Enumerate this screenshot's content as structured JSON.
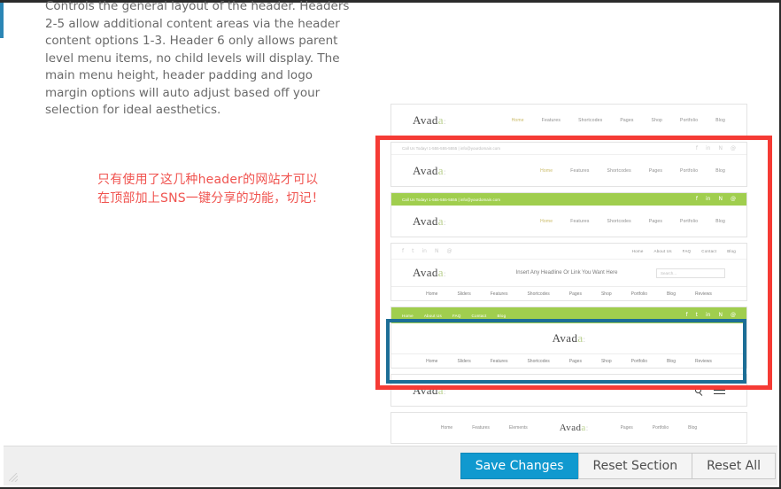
{
  "description": "Controls the general layout of the header. Headers 2-5 allow additional content areas via the header content options 1-3. Header 6 only allows parent level menu items, no child levels will display. The main menu height, header padding and logo margin options will auto adjust based off your selection for ideal aesthetics.",
  "annotation": {
    "line1": "只有使用了这几种header的网站才可以",
    "line2": "在顶部加上SNS一键分享的功能，切记！",
    "color": "#f0534f"
  },
  "colors": {
    "accent_blue": "#1099cf",
    "highlight_red": "#f53b35",
    "highlight_blue": "#1c6e96",
    "avada_green": "#a0ce4e",
    "menu_active": "#c9b964"
  },
  "logo": {
    "main": "Avad",
    "accent": "a",
    "mark": ":"
  },
  "common": {
    "contact": "Call Us Today! 1-555-555-5555 | info@yourdomain.com",
    "search_placeholder": "Search...",
    "headline": "Insert Any Headline Or Link You Want Here"
  },
  "socials": [
    {
      "name": "facebook-icon",
      "glyph": "f"
    },
    {
      "name": "twitter-icon",
      "glyph": "t"
    },
    {
      "name": "linkedin-icon",
      "glyph": "in"
    },
    {
      "name": "flickr-icon",
      "glyph": "N"
    },
    {
      "name": "rss-icon",
      "glyph": "@"
    }
  ],
  "headers": [
    {
      "id": "header-1",
      "selected": false,
      "menu": [
        "Home",
        "Features",
        "Shortcodes",
        "Pages",
        "Shop",
        "Portfolio",
        "Blog"
      ],
      "active_index": 0
    },
    {
      "id": "header-2",
      "selected": false,
      "menu": [
        "Home",
        "Features",
        "Shortcodes",
        "Pages",
        "Portfolio",
        "Blog"
      ],
      "active_index": 0,
      "topbar_style": "light"
    },
    {
      "id": "header-3",
      "selected": false,
      "menu": [
        "Home",
        "Features",
        "Shortcodes",
        "Pages",
        "Portfolio",
        "Blog"
      ],
      "active_index": 0,
      "topbar_style": "green"
    },
    {
      "id": "header-4",
      "selected": false,
      "secondary_menu": [
        "Home",
        "About Us",
        "FAQ",
        "Contact",
        "Blog"
      ],
      "menu": [
        "Home",
        "Sliders",
        "Features",
        "Shortcodes",
        "Pages",
        "Shop",
        "Portfolio",
        "Blog",
        "Reviews"
      ]
    },
    {
      "id": "header-5",
      "selected": true,
      "secondary_menu": [
        "Home",
        "About Us",
        "FAQ",
        "Contact",
        "Blog"
      ],
      "menu": [
        "Home",
        "Sliders",
        "Features",
        "Shortcodes",
        "Pages",
        "Shop",
        "Portfolio",
        "Blog",
        "Reviews"
      ]
    },
    {
      "id": "header-6",
      "selected": false,
      "icons": [
        "search-icon",
        "hamburger-menu-icon"
      ]
    },
    {
      "id": "header-7",
      "selected": false,
      "menu_left": [
        "Home",
        "Features",
        "Elements"
      ],
      "menu_right": [
        "Pages",
        "Portfolio",
        "Blog"
      ]
    }
  ],
  "actions": {
    "save": "Save Changes",
    "reset_section": "Reset Section",
    "reset_all": "Reset All"
  }
}
